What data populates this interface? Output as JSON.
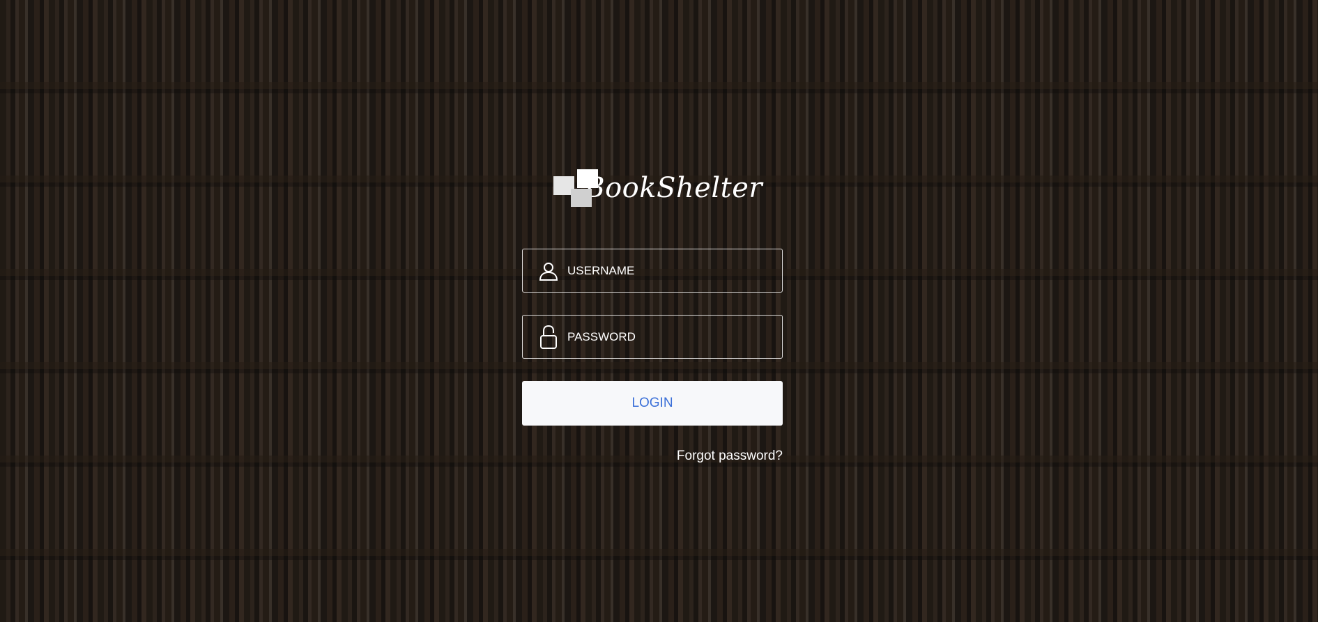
{
  "app": {
    "brand_name": "BookShelter"
  },
  "login_form": {
    "username": {
      "placeholder": "USERNAME",
      "value": "",
      "icon": "user-icon"
    },
    "password": {
      "placeholder": "PASSWORD",
      "value": "",
      "icon": "lock-icon"
    },
    "login_label": "LOGIN",
    "forgot_label": "Forgot password?"
  },
  "colors": {
    "login_text": "#3a6fd8",
    "login_bg": "#f7f8fa",
    "field_border": "#ffffff"
  }
}
